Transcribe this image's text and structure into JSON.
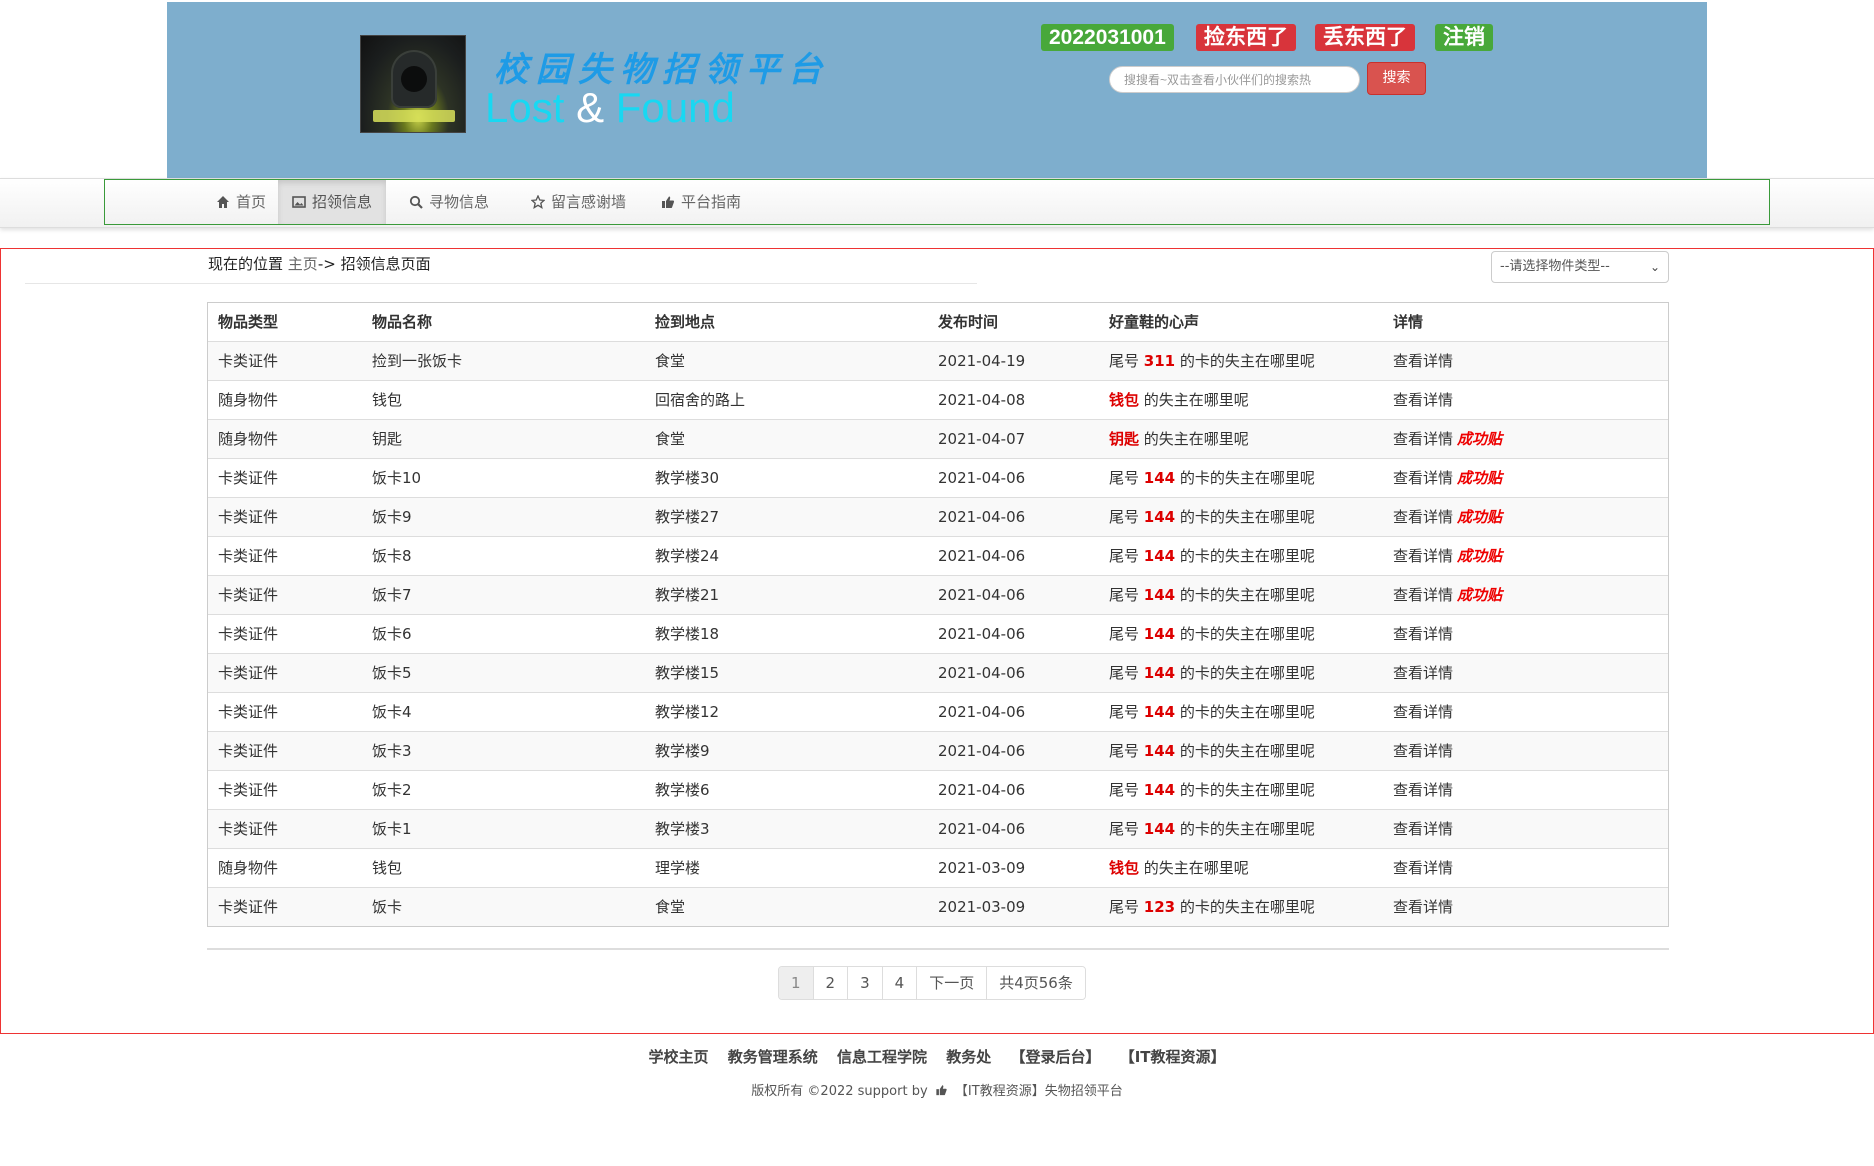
{
  "header": {
    "title": "校园失物招领平台",
    "subtitle_a": "Lost",
    "subtitle_amp": "&",
    "subtitle_b": "Found",
    "user_id": "2022031001",
    "pick_label": "捡东西了",
    "lose_label": "丢东西了",
    "logout_label": "注销",
    "search_placeholder": "搜搜看~双击查看小伙伴们的搜索热",
    "search_label": "搜索"
  },
  "nav": {
    "items": [
      {
        "label": "首页",
        "icon": "home-icon"
      },
      {
        "label": "招领信息",
        "icon": "picture-icon",
        "active": true
      },
      {
        "label": "寻物信息",
        "icon": "zoom-icon"
      },
      {
        "label": "留言感谢墙",
        "icon": "star-icon"
      },
      {
        "label": "平台指南",
        "icon": "thumbs-up-icon"
      }
    ]
  },
  "breadcrumb": {
    "prefix": "现在的位置",
    "home": "主页",
    "sep": "->",
    "current": "招领信息页面"
  },
  "filter": {
    "selected": "--请选择物件类型--"
  },
  "table": {
    "headers": [
      "物品类型",
      "物品名称",
      "捡到地点",
      "发布时间",
      "好童鞋的心声",
      "详情"
    ],
    "detail_label": "查看详情",
    "success_label": "成功贴",
    "rows": [
      {
        "type": "卡类证件",
        "name": "捡到一张饭卡",
        "place": "食堂",
        "date": "2021-04-19",
        "msg_pre": "尾号",
        "msg_hl": "311",
        "msg_post": "的卡的失主在哪里呢",
        "success": false
      },
      {
        "type": "随身物件",
        "name": "钱包",
        "place": "回宿舍的路上",
        "date": "2021-04-08",
        "msg_pre": "",
        "msg_hl": "钱包",
        "msg_post": "的失主在哪里呢",
        "success": false
      },
      {
        "type": "随身物件",
        "name": "钥匙",
        "place": "食堂",
        "date": "2021-04-07",
        "msg_pre": "",
        "msg_hl": "钥匙",
        "msg_post": "的失主在哪里呢",
        "success": true
      },
      {
        "type": "卡类证件",
        "name": "饭卡10",
        "place": "教学楼30",
        "date": "2021-04-06",
        "msg_pre": "尾号",
        "msg_hl": "144",
        "msg_post": "的卡的失主在哪里呢",
        "success": true
      },
      {
        "type": "卡类证件",
        "name": "饭卡9",
        "place": "教学楼27",
        "date": "2021-04-06",
        "msg_pre": "尾号",
        "msg_hl": "144",
        "msg_post": "的卡的失主在哪里呢",
        "success": true
      },
      {
        "type": "卡类证件",
        "name": "饭卡8",
        "place": "教学楼24",
        "date": "2021-04-06",
        "msg_pre": "尾号",
        "msg_hl": "144",
        "msg_post": "的卡的失主在哪里呢",
        "success": true
      },
      {
        "type": "卡类证件",
        "name": "饭卡7",
        "place": "教学楼21",
        "date": "2021-04-06",
        "msg_pre": "尾号",
        "msg_hl": "144",
        "msg_post": "的卡的失主在哪里呢",
        "success": true
      },
      {
        "type": "卡类证件",
        "name": "饭卡6",
        "place": "教学楼18",
        "date": "2021-04-06",
        "msg_pre": "尾号",
        "msg_hl": "144",
        "msg_post": "的卡的失主在哪里呢",
        "success": false
      },
      {
        "type": "卡类证件",
        "name": "饭卡5",
        "place": "教学楼15",
        "date": "2021-04-06",
        "msg_pre": "尾号",
        "msg_hl": "144",
        "msg_post": "的卡的失主在哪里呢",
        "success": false
      },
      {
        "type": "卡类证件",
        "name": "饭卡4",
        "place": "教学楼12",
        "date": "2021-04-06",
        "msg_pre": "尾号",
        "msg_hl": "144",
        "msg_post": "的卡的失主在哪里呢",
        "success": false
      },
      {
        "type": "卡类证件",
        "name": "饭卡3",
        "place": "教学楼9",
        "date": "2021-04-06",
        "msg_pre": "尾号",
        "msg_hl": "144",
        "msg_post": "的卡的失主在哪里呢",
        "success": false
      },
      {
        "type": "卡类证件",
        "name": "饭卡2",
        "place": "教学楼6",
        "date": "2021-04-06",
        "msg_pre": "尾号",
        "msg_hl": "144",
        "msg_post": "的卡的失主在哪里呢",
        "success": false
      },
      {
        "type": "卡类证件",
        "name": "饭卡1",
        "place": "教学楼3",
        "date": "2021-04-06",
        "msg_pre": "尾号",
        "msg_hl": "144",
        "msg_post": "的卡的失主在哪里呢",
        "success": false
      },
      {
        "type": "随身物件",
        "name": "钱包",
        "place": "理学楼",
        "date": "2021-03-09",
        "msg_pre": "",
        "msg_hl": "钱包",
        "msg_post": "的失主在哪里呢",
        "success": false
      },
      {
        "type": "卡类证件",
        "name": "饭卡",
        "place": "食堂",
        "date": "2021-03-09",
        "msg_pre": "尾号",
        "msg_hl": "123",
        "msg_post": "的卡的失主在哪里呢",
        "success": false
      }
    ]
  },
  "pagination": {
    "pages": [
      "1",
      "2",
      "3",
      "4"
    ],
    "current": "1",
    "next_label": "下一页",
    "summary": "共4页56条"
  },
  "footer": {
    "links": [
      "学校主页",
      "教务管理系统",
      "信息工程学院",
      "教务处",
      "【登录后台】",
      "【IT教程资源】"
    ],
    "copyright_pre": "版权所有 ©2022 support by",
    "copyright_post": "【IT教程资源】失物招领平台"
  },
  "colors": {
    "header_bg": "#7eaecd",
    "green_badge": "#48a83a",
    "red_badge": "#d8343b",
    "highlight": "#dd0000",
    "content_border": "#ee3333"
  }
}
